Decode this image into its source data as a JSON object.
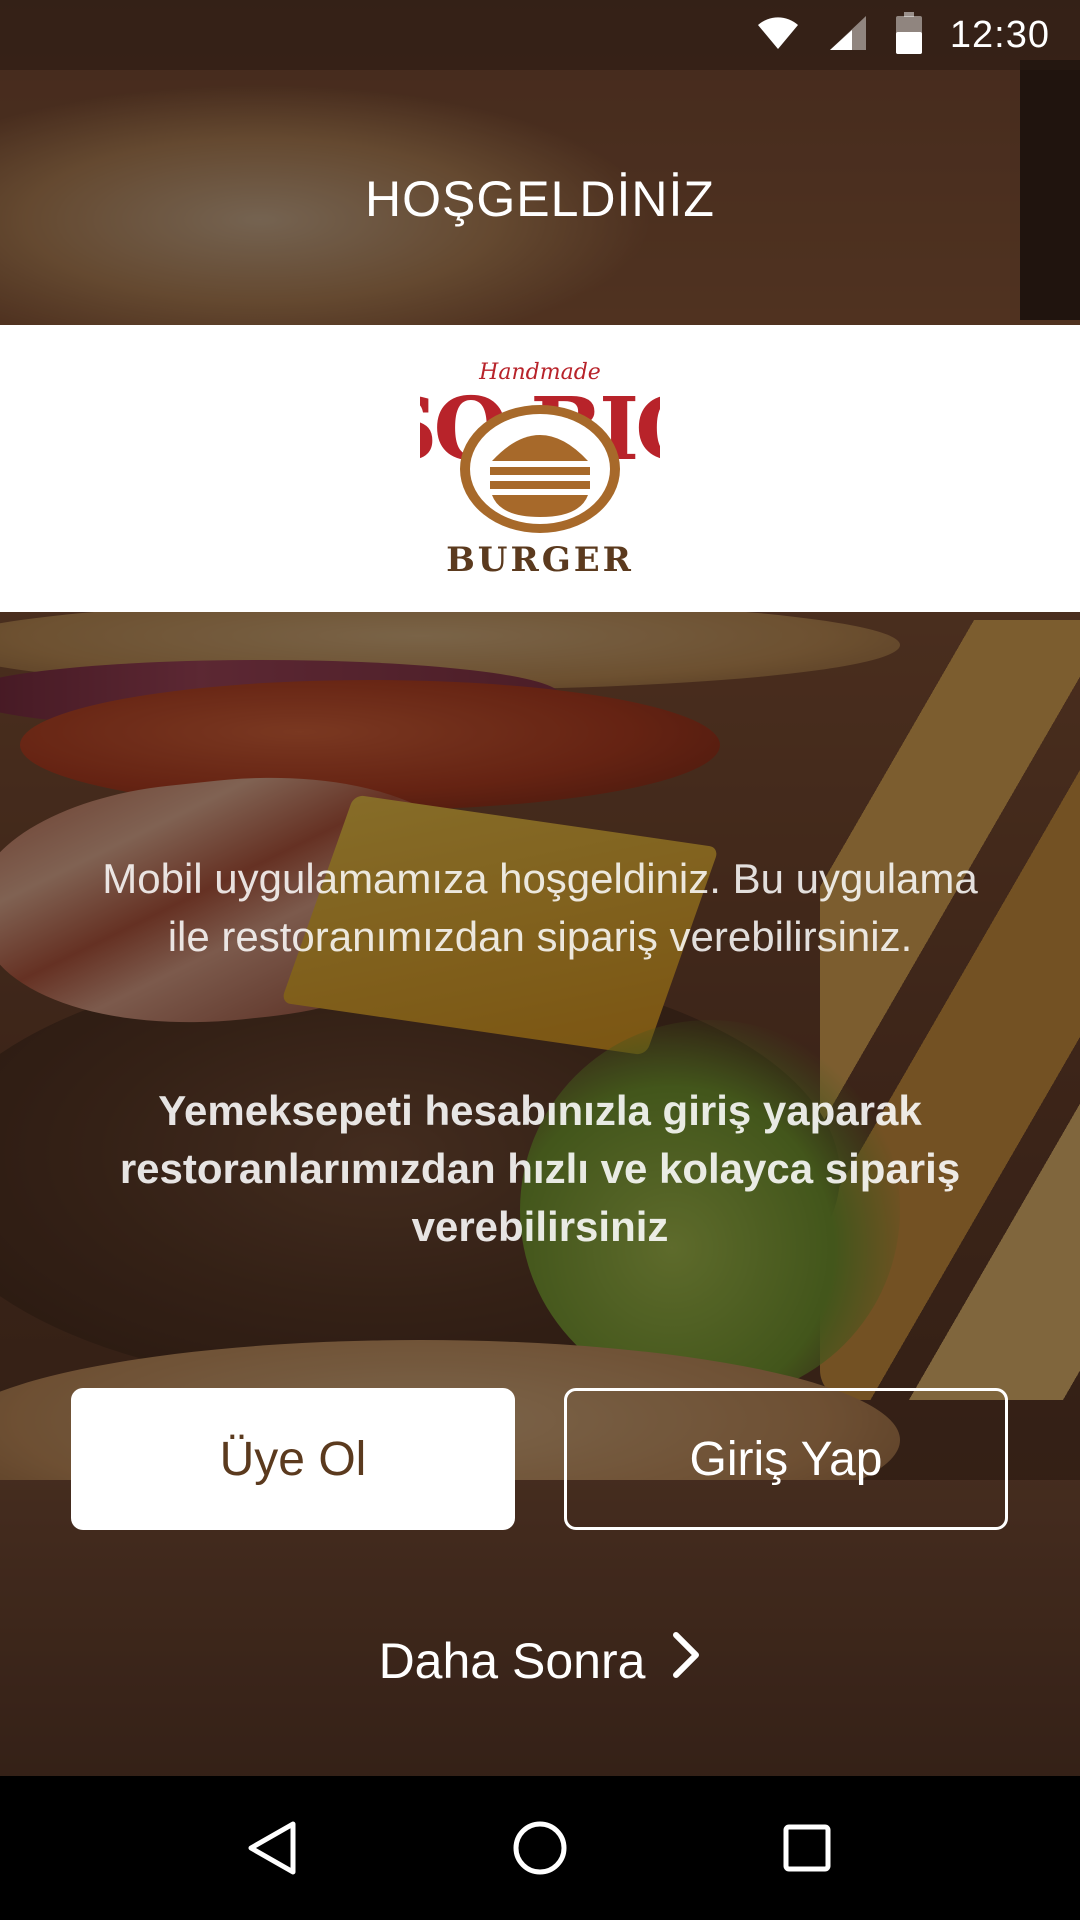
{
  "status_bar": {
    "time": "12:30",
    "icons": [
      "wifi-icon",
      "cellular-signal-icon",
      "battery-icon"
    ]
  },
  "header": {
    "title": "HOŞGELDİNİZ"
  },
  "logo": {
    "script_text": "Handmade",
    "main_text": "SO BIG",
    "sub_text": "BURGER",
    "colors": {
      "red": "#b8232a",
      "brown": "#a7692a"
    }
  },
  "content": {
    "intro_text": "Mobil uygulamamıza hoşgeldiniz. Bu uygulama ile restoranımızdan sipariş verebilirsiniz.",
    "intro_bold_text": "Yemeksepeti hesabınızla giriş yaparak restoranlarımızdan hızlı ve kolayca sipariş verebilirsiniz"
  },
  "actions": {
    "register_label": "Üye Ol",
    "login_label": "Giriş Yap",
    "later_label": "Daha Sonra",
    "later_icon": "chevron-right-icon"
  },
  "nav_bar": {
    "buttons": [
      "back-icon",
      "home-icon",
      "recents-icon"
    ]
  },
  "colors": {
    "button_text_brown": "#5b3a1e",
    "overlay": "rgba(35,20,12,0.55)",
    "white": "#ffffff",
    "nav_bg": "#000000"
  }
}
